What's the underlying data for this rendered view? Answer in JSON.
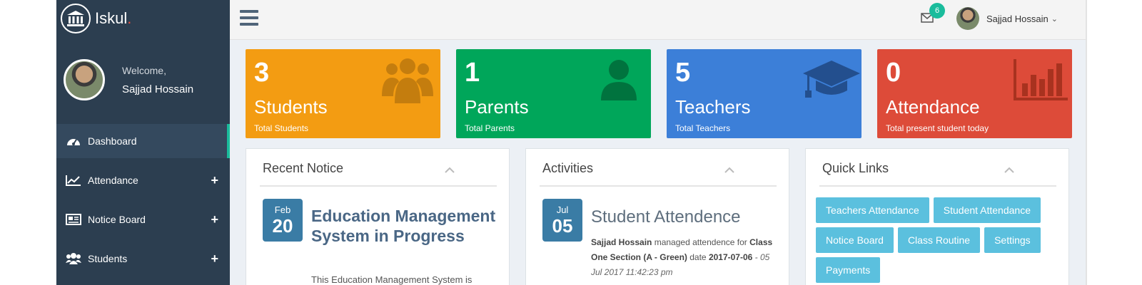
{
  "brand": {
    "name": "Iskul"
  },
  "sidebar": {
    "welcome": "Welcome,",
    "user_name": "Sajjad Hossain",
    "items": [
      {
        "label": "Dashboard",
        "icon": "dashboard-icon",
        "expandable": false
      },
      {
        "label": "Attendance",
        "icon": "line-chart-icon",
        "expandable": true
      },
      {
        "label": "Notice Board",
        "icon": "newspaper-icon",
        "expandable": true
      },
      {
        "label": "Students",
        "icon": "users-icon",
        "expandable": true
      }
    ],
    "expand_symbol": "+"
  },
  "header": {
    "mail_count": "6",
    "user_name": "Sajjad Hossain",
    "caret": "⌄"
  },
  "stats": [
    {
      "count": "3",
      "label": "Students",
      "sub": "Total Students",
      "color": "#f39c12",
      "icon": "users-icon"
    },
    {
      "count": "1",
      "label": "Parents",
      "sub": "Total Parents",
      "color": "#00a65a",
      "icon": "user-icon"
    },
    {
      "count": "5",
      "label": "Teachers",
      "sub": "Total Teachers",
      "color": "#3c7fd8",
      "icon": "graduation-cap-icon"
    },
    {
      "count": "0",
      "label": "Attendance",
      "sub": "Total present student today",
      "color": "#dd4b39",
      "icon": "bar-chart-icon"
    }
  ],
  "recent_notice": {
    "title": "Recent Notice",
    "month": "Feb",
    "day": "20",
    "heading": "Education Management System in Progress",
    "body": "This Education Management System is"
  },
  "activities": {
    "title": "Activities",
    "month": "Jul",
    "day": "05",
    "heading": "Student Attendence",
    "actor": "Sajjad Hossain",
    "action": " managed attendence for ",
    "target": "Class One Section (A - Green)",
    "date_word": " date ",
    "date": "2017-07-06",
    "timestamp": " - 05 Jul 2017 11:42:23 pm"
  },
  "quick_links": {
    "title": "Quick Links",
    "links": [
      "Teachers Attendance",
      "Student Attendance",
      "Notice Board",
      "Class Routine",
      "Settings",
      "Payments"
    ]
  }
}
